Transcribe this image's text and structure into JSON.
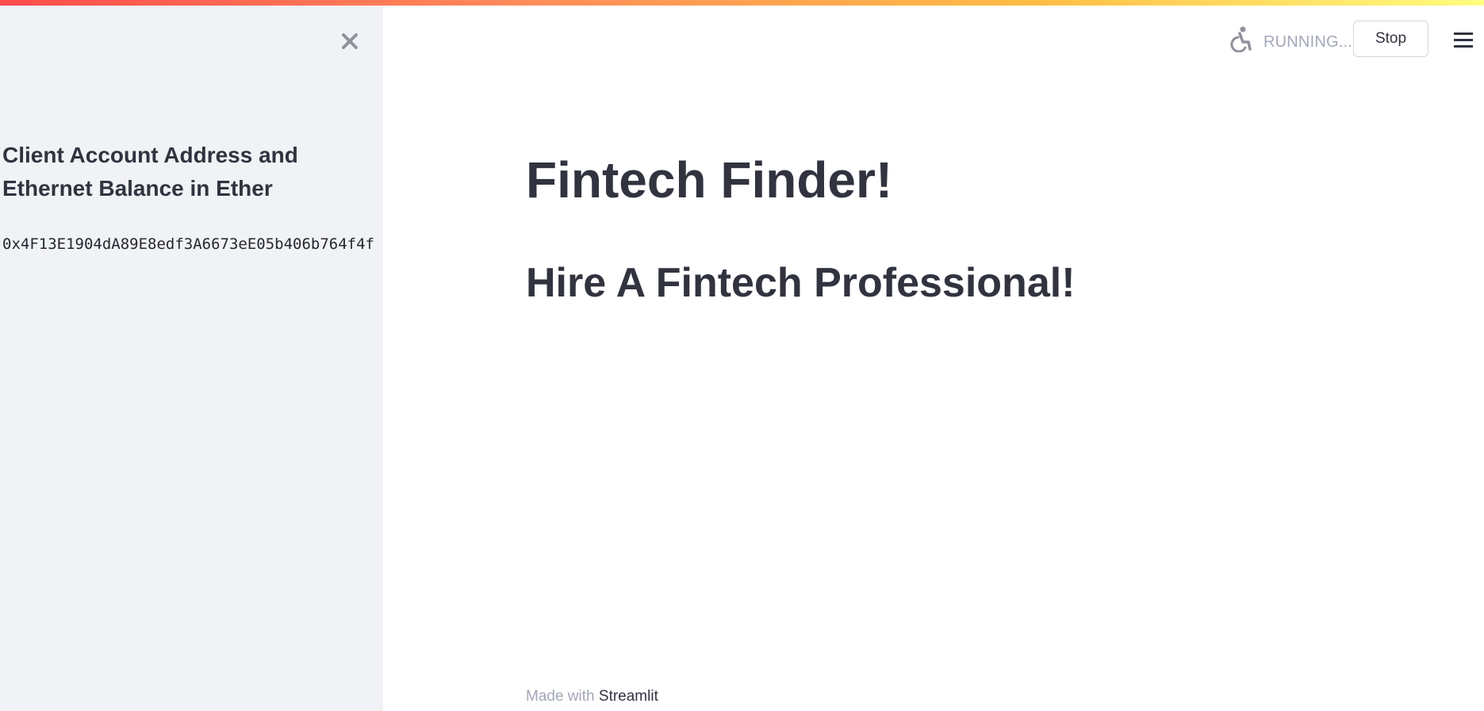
{
  "colors": {
    "sidebar_bg": "#f0f2f6",
    "text": "#31333f",
    "muted": "#a3a8b8",
    "accent_gradient": [
      "#ff4b4b",
      "#ffbd45",
      "#fffd80"
    ]
  },
  "sidebar": {
    "close_icon": "close-icon",
    "heading": "Client Account Address and Ethernet Balance in Ether",
    "account_address": "0x4F13E1904dA89E8edf3A6673eE05b406b764f4f"
  },
  "header": {
    "status_icon": "running-person-icon",
    "status_text": "RUNNING...",
    "stop_label": "Stop",
    "menu_icon": "hamburger-menu-icon"
  },
  "main": {
    "title": "Fintech Finder!",
    "subtitle": "Hire A Fintech Professional!"
  },
  "footer": {
    "prefix": "Made with",
    "link_text": "Streamlit"
  }
}
